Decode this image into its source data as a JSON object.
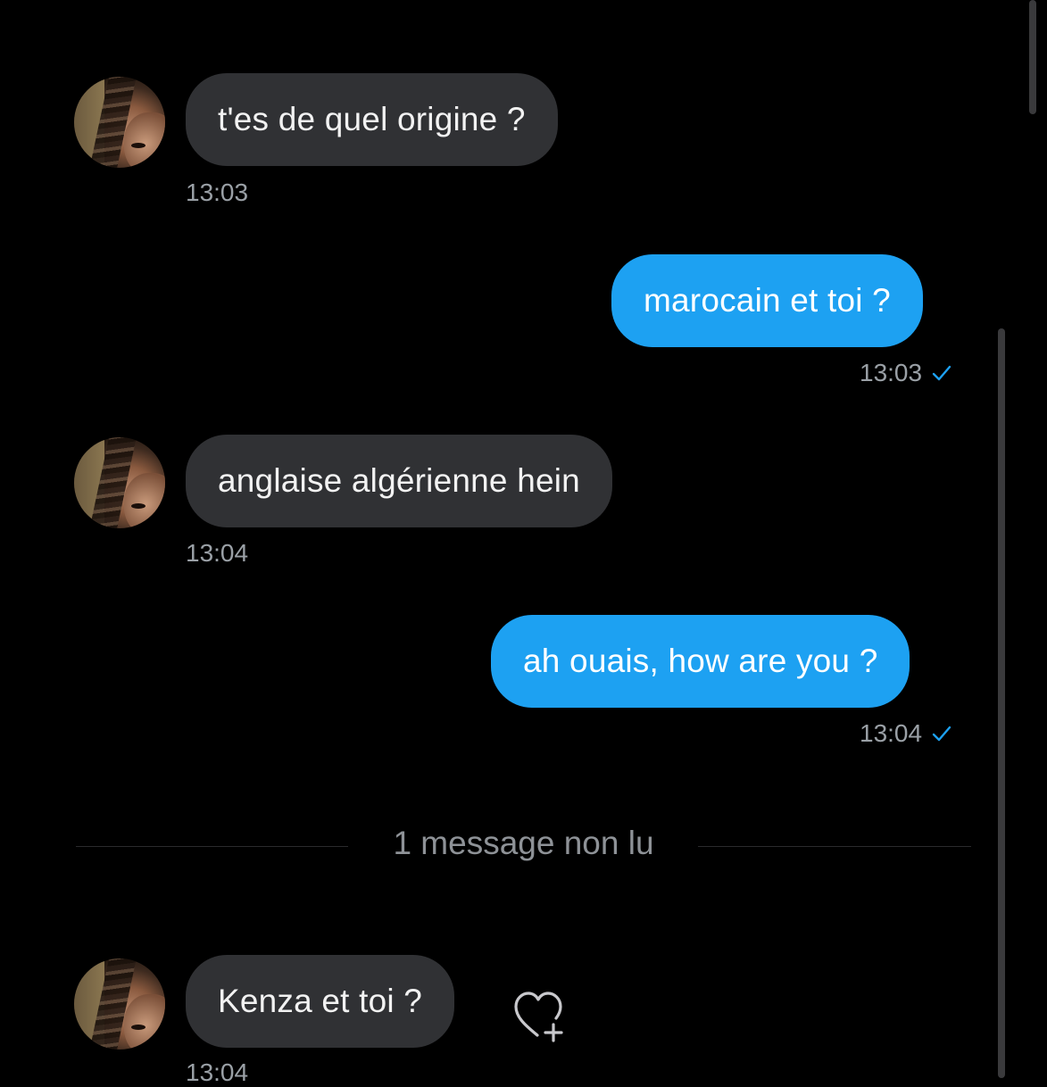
{
  "messages": [
    {
      "direction": "incoming",
      "text": "t'es de quel origine ?",
      "time": "13:03"
    },
    {
      "direction": "outgoing",
      "text": "marocain et toi ?",
      "time": "13:03"
    },
    {
      "direction": "incoming",
      "text": "anglaise algérienne hein",
      "time": "13:04"
    },
    {
      "direction": "outgoing",
      "text": "ah ouais, how are you ?",
      "time": "13:04"
    },
    {
      "direction": "incoming",
      "text": "Kenza et toi ?",
      "time": "13:04"
    }
  ],
  "unread_divider": "1 message non lu",
  "icons": {
    "read_receipt": "checkmark-icon",
    "reaction": "heart-plus-icon"
  },
  "colors": {
    "background": "#000000",
    "incoming_bubble": "#303134",
    "outgoing_bubble": "#1da1f2",
    "timestamp": "#9aa0a6",
    "check": "#1da1f2"
  }
}
